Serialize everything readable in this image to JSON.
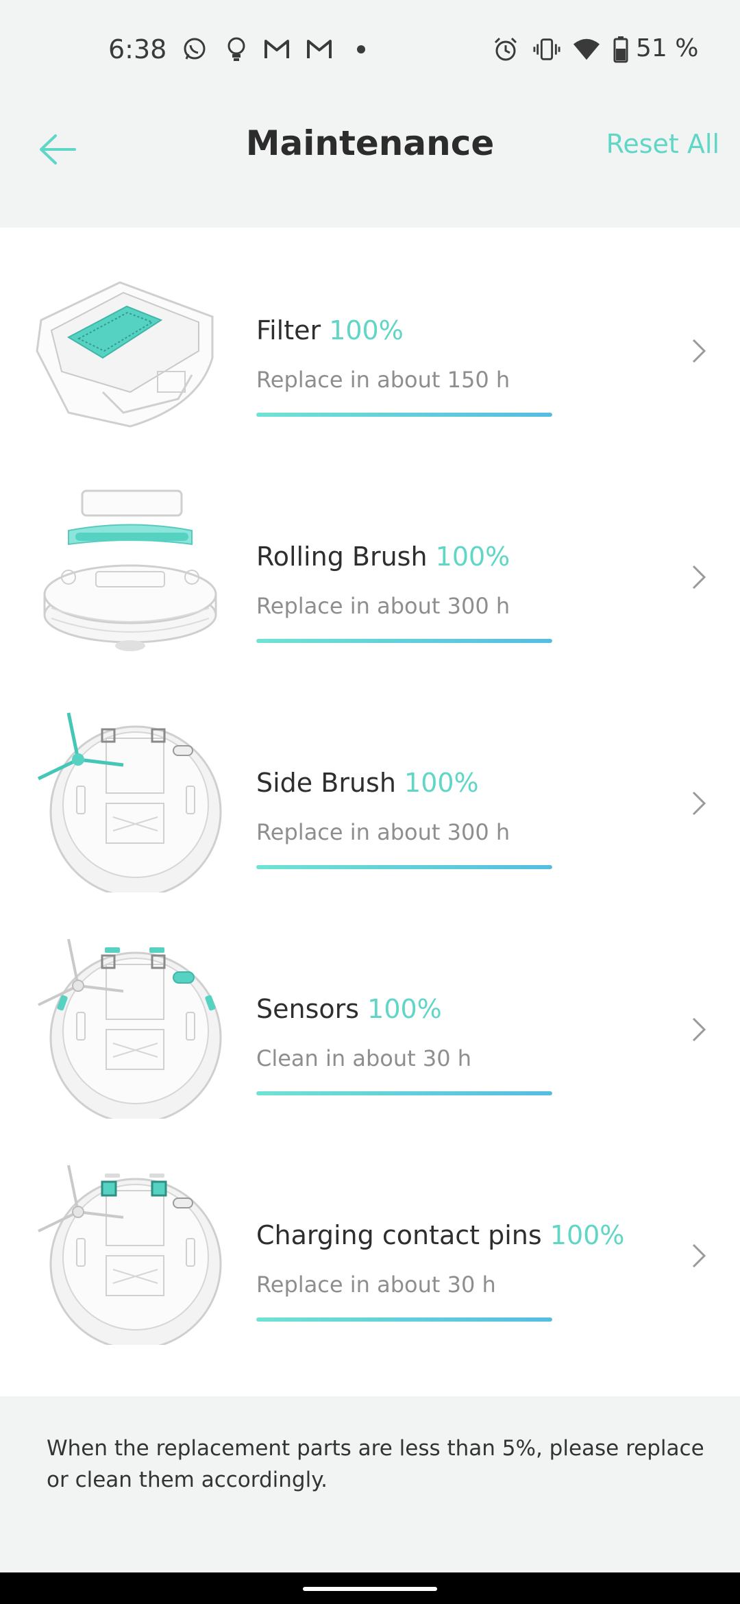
{
  "status_bar": {
    "time": "6:38",
    "battery_percent": "51 %",
    "icons": [
      "whatsapp-icon",
      "bulb-icon",
      "gmail-icon",
      "gmail-icon",
      "dot-icon",
      "alarm-icon",
      "vibrate-icon",
      "wifi-icon",
      "battery-icon"
    ]
  },
  "header": {
    "title": "Maintenance",
    "reset_label": "Reset All",
    "back_icon": "arrow-left-icon"
  },
  "colors": {
    "accent": "#5fd6c6",
    "bar_start": "#6fe3d4",
    "bar_end": "#55bde0"
  },
  "items": [
    {
      "name": "Filter",
      "percent": "100%",
      "subtitle": "Replace in about 150 h",
      "progress": 1.0,
      "image": "filter-image"
    },
    {
      "name": "Rolling Brush",
      "percent": "100%",
      "subtitle": "Replace in about 300 h",
      "progress": 1.0,
      "image": "rolling-brush-image"
    },
    {
      "name": "Side Brush",
      "percent": "100%",
      "subtitle": "Replace in about 300 h",
      "progress": 1.0,
      "image": "side-brush-image"
    },
    {
      "name": "Sensors",
      "percent": "100%",
      "subtitle": "Clean in about 30 h",
      "progress": 1.0,
      "image": "sensors-image"
    },
    {
      "name": "Charging contact pins",
      "percent": "100%",
      "subtitle": "Replace in about 30 h",
      "progress": 1.0,
      "image": "charging-pins-image"
    }
  ],
  "note": "When the replacement parts are less than 5%, please replace or clean them accordingly."
}
